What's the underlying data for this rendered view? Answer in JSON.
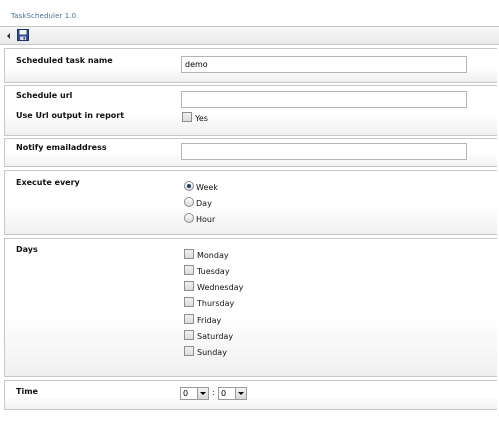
{
  "window": {
    "title": "TaskScheduler 1.0"
  },
  "toolbar": {
    "back_icon": "arrow-left-icon",
    "save_icon": "floppy-disk-icon"
  },
  "form": {
    "task_name": {
      "label": "Scheduled task name",
      "value": "demo"
    },
    "schedule_url": {
      "label": "Schedule url",
      "value": ""
    },
    "use_url_output": {
      "label": "Use Url output in report",
      "option": "Yes",
      "checked": false
    },
    "notify_email": {
      "label": "Notify emailaddress",
      "value": ""
    },
    "execute_every": {
      "label": "Execute every",
      "options": [
        "Week",
        "Day",
        "Hour"
      ],
      "selected": "Week"
    },
    "days": {
      "label": "Days",
      "options": [
        "Monday",
        "Tuesday",
        "Wednesday",
        "Thursday",
        "Friday",
        "Saturday",
        "Sunday"
      ]
    },
    "time": {
      "label": "Time",
      "hour": "0",
      "separator": ":",
      "minute": "0"
    }
  },
  "colors": {
    "title_text": "#4a6f98",
    "border": "#c8c8c8",
    "radio_dot": "#1f3f6b"
  }
}
